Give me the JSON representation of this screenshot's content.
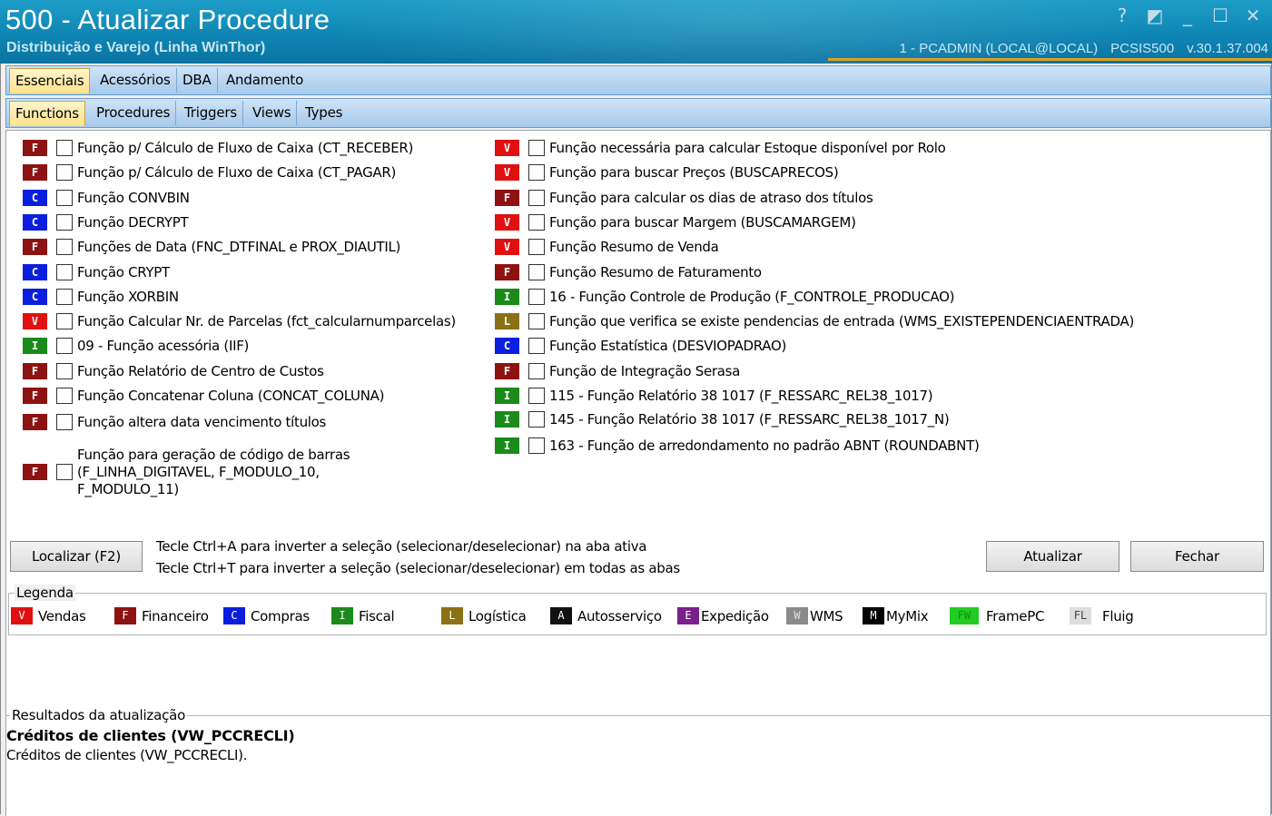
{
  "window": {
    "title": "500 - Atualizar Procedure",
    "subtitle": "Distribuição e Varejo (Linha WinThor)",
    "user": "1 - PCADMIN (LOCAL@LOCAL)",
    "module": "PCSIS500",
    "version": "v.30.1.37.004",
    "controls": {
      "help": "?",
      "restore": "◩",
      "minimize": "_",
      "maximize": "☐",
      "close": "✕"
    }
  },
  "main_tabs": [
    {
      "label": "Essenciais",
      "active": true
    },
    {
      "label": "Acessórios",
      "active": false
    },
    {
      "label": "DBA",
      "active": false
    },
    {
      "label": "Andamento",
      "active": false
    }
  ],
  "sub_tabs": [
    {
      "label": "Functions",
      "active": true
    },
    {
      "label": "Procedures",
      "active": false
    },
    {
      "label": "Triggers",
      "active": false
    },
    {
      "label": "Views",
      "active": false
    },
    {
      "label": "Types",
      "active": false
    }
  ],
  "left_items": [
    {
      "badge": "F",
      "label": "Função p/ Cálculo de Fluxo de Caixa (CT_RECEBER)",
      "checked": false
    },
    {
      "badge": "F",
      "label": "Função p/ Cálculo de Fluxo de Caixa (CT_PAGAR)",
      "checked": false
    },
    {
      "badge": "C",
      "label": "Função CONVBIN",
      "checked": false
    },
    {
      "badge": "C",
      "label": "Função DECRYPT",
      "checked": false
    },
    {
      "badge": "F",
      "label": "Funções de Data (FNC_DTFINAL e PROX_DIAUTIL)",
      "checked": false
    },
    {
      "badge": "C",
      "label": "Função CRYPT",
      "checked": false
    },
    {
      "badge": "C",
      "label": "Função XORBIN",
      "checked": false
    },
    {
      "badge": "V",
      "label": "Função Calcular Nr. de Parcelas (fct_calcularnumparcelas)",
      "checked": false
    },
    {
      "badge": "I",
      "label": "09 - Função acessória (IIF)",
      "checked": false
    },
    {
      "badge": "F",
      "label": "Função Relatório de Centro de Custos",
      "checked": false
    },
    {
      "badge": "F",
      "label": "Função Concatenar Coluna (CONCAT_COLUNA)",
      "checked": false
    },
    {
      "badge": "F",
      "label": "Função altera data vencimento títulos",
      "checked": false
    },
    {
      "badge": "F",
      "label": "Função para geração de código de barras (F_LINHA_DIGITAVEL, F_MODULO_10, F_MODULO_11)",
      "checked": false
    }
  ],
  "right_items": [
    {
      "badge": "V",
      "label": "Função necessária para calcular Estoque disponível por Rolo",
      "checked": false
    },
    {
      "badge": "V",
      "label": "Função para buscar Preços (BUSCAPRECOS)",
      "checked": false
    },
    {
      "badge": "F",
      "label": "Função para calcular os dias de atraso dos títulos",
      "checked": false
    },
    {
      "badge": "V",
      "label": "Função para buscar Margem (BUSCAMARGEM)",
      "checked": false
    },
    {
      "badge": "V",
      "label": "Função Resumo de Venda",
      "checked": false
    },
    {
      "badge": "F",
      "label": "Função Resumo de Faturamento",
      "checked": false
    },
    {
      "badge": "I",
      "label": "16 - Função Controle de Produção (F_CONTROLE_PRODUCAO)",
      "checked": false
    },
    {
      "badge": "L",
      "label": "Função que verifica se existe pendencias de entrada (WMS_EXISTEPENDENCIAENTRADA)",
      "checked": false
    },
    {
      "badge": "C",
      "label": "Função Estatística (DESVIOPADRAO)",
      "checked": false
    },
    {
      "badge": "F",
      "label": "Função de Integração Serasa",
      "checked": false
    },
    {
      "badge": "I",
      "label": "115 - Função Relatório 38 1017 (F_RESSARC_REL38_1017)",
      "checked": false
    },
    {
      "badge": "I",
      "label": "145 - Função Relatório 38 1017 (F_RESSARC_REL38_1017_N)",
      "checked": false
    },
    {
      "badge": "I",
      "label": "163 - Função de arredondamento no padrão ABNT (ROUNDABNT)",
      "checked": false
    }
  ],
  "actions": {
    "localizar": "Localizar (F2)",
    "atualizar": "Atualizar",
    "fechar": "Fechar",
    "hint1": "Tecle Ctrl+A para inverter a seleção (selecionar/deselecionar) na aba ativa",
    "hint2": "Tecle Ctrl+T para inverter a seleção (selecionar/deselecionar) em todas as abas"
  },
  "legend": {
    "title": "Legenda",
    "items": [
      {
        "code": "V",
        "label": "Vendas",
        "color": "#e01010"
      },
      {
        "code": "F",
        "label": "Financeiro",
        "color": "#8e1212"
      },
      {
        "code": "C",
        "label": "Compras",
        "color": "#0a1ee0"
      },
      {
        "code": "I",
        "label": "Fiscal",
        "color": "#1a8a1a"
      },
      {
        "code": "L",
        "label": "Logística",
        "color": "#8b7015"
      },
      {
        "code": "A",
        "label": "Autosserviço",
        "color": "#111111"
      },
      {
        "code": "E",
        "label": "Expedição",
        "color": "#7a1f8c"
      },
      {
        "code": "W",
        "label": "WMS",
        "color": "#8a8a8a"
      },
      {
        "code": "M",
        "label": "MyMix",
        "color": "#000000"
      },
      {
        "code": "FW",
        "label": "FramePC",
        "color": "#22cc22"
      },
      {
        "code": "FL",
        "label": "Fluig",
        "color": "#dddddd"
      }
    ]
  },
  "results": {
    "title": "Resultados da atualização",
    "heading": "Créditos de clientes (VW_PCCRECLI)",
    "line": "Créditos de clientes (VW_PCCRECLI)."
  }
}
